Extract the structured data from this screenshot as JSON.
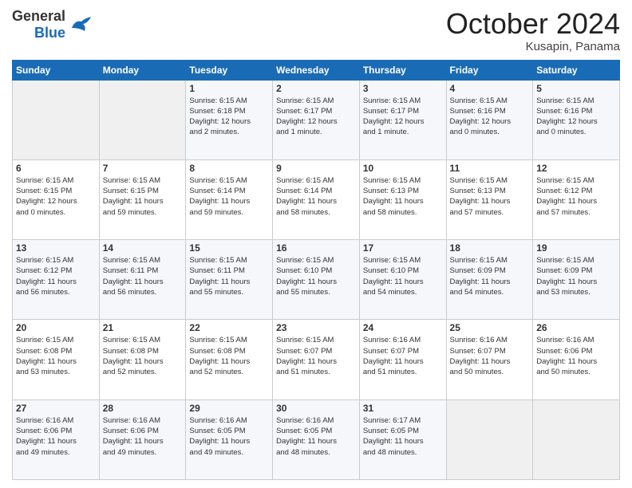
{
  "header": {
    "logo_line1": "General",
    "logo_line2": "Blue",
    "month": "October 2024",
    "location": "Kusapin, Panama"
  },
  "calendar": {
    "days_of_week": [
      "Sunday",
      "Monday",
      "Tuesday",
      "Wednesday",
      "Thursday",
      "Friday",
      "Saturday"
    ],
    "weeks": [
      [
        {
          "day": "",
          "info": ""
        },
        {
          "day": "",
          "info": ""
        },
        {
          "day": "1",
          "info": "Sunrise: 6:15 AM\nSunset: 6:18 PM\nDaylight: 12 hours\nand 2 minutes."
        },
        {
          "day": "2",
          "info": "Sunrise: 6:15 AM\nSunset: 6:17 PM\nDaylight: 12 hours\nand 1 minute."
        },
        {
          "day": "3",
          "info": "Sunrise: 6:15 AM\nSunset: 6:17 PM\nDaylight: 12 hours\nand 1 minute."
        },
        {
          "day": "4",
          "info": "Sunrise: 6:15 AM\nSunset: 6:16 PM\nDaylight: 12 hours\nand 0 minutes."
        },
        {
          "day": "5",
          "info": "Sunrise: 6:15 AM\nSunset: 6:16 PM\nDaylight: 12 hours\nand 0 minutes."
        }
      ],
      [
        {
          "day": "6",
          "info": "Sunrise: 6:15 AM\nSunset: 6:15 PM\nDaylight: 12 hours\nand 0 minutes."
        },
        {
          "day": "7",
          "info": "Sunrise: 6:15 AM\nSunset: 6:15 PM\nDaylight: 11 hours\nand 59 minutes."
        },
        {
          "day": "8",
          "info": "Sunrise: 6:15 AM\nSunset: 6:14 PM\nDaylight: 11 hours\nand 59 minutes."
        },
        {
          "day": "9",
          "info": "Sunrise: 6:15 AM\nSunset: 6:14 PM\nDaylight: 11 hours\nand 58 minutes."
        },
        {
          "day": "10",
          "info": "Sunrise: 6:15 AM\nSunset: 6:13 PM\nDaylight: 11 hours\nand 58 minutes."
        },
        {
          "day": "11",
          "info": "Sunrise: 6:15 AM\nSunset: 6:13 PM\nDaylight: 11 hours\nand 57 minutes."
        },
        {
          "day": "12",
          "info": "Sunrise: 6:15 AM\nSunset: 6:12 PM\nDaylight: 11 hours\nand 57 minutes."
        }
      ],
      [
        {
          "day": "13",
          "info": "Sunrise: 6:15 AM\nSunset: 6:12 PM\nDaylight: 11 hours\nand 56 minutes."
        },
        {
          "day": "14",
          "info": "Sunrise: 6:15 AM\nSunset: 6:11 PM\nDaylight: 11 hours\nand 56 minutes."
        },
        {
          "day": "15",
          "info": "Sunrise: 6:15 AM\nSunset: 6:11 PM\nDaylight: 11 hours\nand 55 minutes."
        },
        {
          "day": "16",
          "info": "Sunrise: 6:15 AM\nSunset: 6:10 PM\nDaylight: 11 hours\nand 55 minutes."
        },
        {
          "day": "17",
          "info": "Sunrise: 6:15 AM\nSunset: 6:10 PM\nDaylight: 11 hours\nand 54 minutes."
        },
        {
          "day": "18",
          "info": "Sunrise: 6:15 AM\nSunset: 6:09 PM\nDaylight: 11 hours\nand 54 minutes."
        },
        {
          "day": "19",
          "info": "Sunrise: 6:15 AM\nSunset: 6:09 PM\nDaylight: 11 hours\nand 53 minutes."
        }
      ],
      [
        {
          "day": "20",
          "info": "Sunrise: 6:15 AM\nSunset: 6:08 PM\nDaylight: 11 hours\nand 53 minutes."
        },
        {
          "day": "21",
          "info": "Sunrise: 6:15 AM\nSunset: 6:08 PM\nDaylight: 11 hours\nand 52 minutes."
        },
        {
          "day": "22",
          "info": "Sunrise: 6:15 AM\nSunset: 6:08 PM\nDaylight: 11 hours\nand 52 minutes."
        },
        {
          "day": "23",
          "info": "Sunrise: 6:15 AM\nSunset: 6:07 PM\nDaylight: 11 hours\nand 51 minutes."
        },
        {
          "day": "24",
          "info": "Sunrise: 6:16 AM\nSunset: 6:07 PM\nDaylight: 11 hours\nand 51 minutes."
        },
        {
          "day": "25",
          "info": "Sunrise: 6:16 AM\nSunset: 6:07 PM\nDaylight: 11 hours\nand 50 minutes."
        },
        {
          "day": "26",
          "info": "Sunrise: 6:16 AM\nSunset: 6:06 PM\nDaylight: 11 hours\nand 50 minutes."
        }
      ],
      [
        {
          "day": "27",
          "info": "Sunrise: 6:16 AM\nSunset: 6:06 PM\nDaylight: 11 hours\nand 49 minutes."
        },
        {
          "day": "28",
          "info": "Sunrise: 6:16 AM\nSunset: 6:06 PM\nDaylight: 11 hours\nand 49 minutes."
        },
        {
          "day": "29",
          "info": "Sunrise: 6:16 AM\nSunset: 6:05 PM\nDaylight: 11 hours\nand 49 minutes."
        },
        {
          "day": "30",
          "info": "Sunrise: 6:16 AM\nSunset: 6:05 PM\nDaylight: 11 hours\nand 48 minutes."
        },
        {
          "day": "31",
          "info": "Sunrise: 6:17 AM\nSunset: 6:05 PM\nDaylight: 11 hours\nand 48 minutes."
        },
        {
          "day": "",
          "info": ""
        },
        {
          "day": "",
          "info": ""
        }
      ]
    ]
  }
}
